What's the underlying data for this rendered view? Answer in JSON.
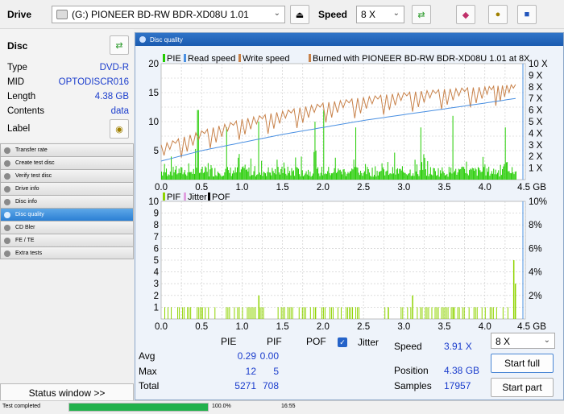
{
  "topbar": {
    "drive_label": "Drive",
    "drive_value": "(G:)   PIONEER BD-RW   BDR-XD08U 1.01",
    "speed_label": "Speed",
    "speed_value": "8 X"
  },
  "disc": {
    "title": "Disc",
    "fields": [
      {
        "key": "Type",
        "value": "DVD-R"
      },
      {
        "key": "MID",
        "value": "OPTODISCR016"
      },
      {
        "key": "Length",
        "value": "4.38 GB"
      },
      {
        "key": "Contents",
        "value": "data"
      }
    ],
    "label_key": "Label"
  },
  "nav": [
    {
      "label": "Transfer rate",
      "active": false
    },
    {
      "label": "Create test disc",
      "active": false
    },
    {
      "label": "Verify test disc",
      "active": false
    },
    {
      "label": "Drive info",
      "active": false
    },
    {
      "label": "Disc info",
      "active": false
    },
    {
      "label": "Disc quality",
      "active": true
    },
    {
      "label": "CD Bler",
      "active": false
    },
    {
      "label": "FE / TE",
      "active": false
    },
    {
      "label": "Extra tests",
      "active": false
    }
  ],
  "status_window_label": "Status window >>",
  "statusbar": {
    "text": "Test completed",
    "progress_value": 100.0,
    "percent": "100.0%",
    "time": "16:55"
  },
  "panel_title": "Disc quality",
  "chart_data": [
    {
      "type": "bar",
      "legend": [
        "PIE",
        "Read speed",
        "Write speed",
        "Burned with PIONEER BD-RW  BDR-XD08U 1.01 at 8X"
      ],
      "x_ticks": [
        "0.0",
        "0.5",
        "1.0",
        "1.5",
        "2.0",
        "2.5",
        "3.0",
        "3.5",
        "4.0",
        "4.5 GB"
      ],
      "y_ticks_left": [
        "5",
        "10",
        "15",
        "20"
      ],
      "y_ticks_right": [
        "1 X",
        "2 X",
        "3 X",
        "4 X",
        "5 X",
        "6 X",
        "7 X",
        "8 X",
        "9 X",
        "10 X"
      ],
      "xlim": [
        0,
        4.5
      ],
      "ylim": [
        0,
        20
      ],
      "y2lim": [
        0,
        10
      ],
      "pie_peaks": [
        [
          0.45,
          12
        ],
        [
          0.8,
          9
        ],
        [
          1.2,
          10
        ],
        [
          1.9,
          10
        ],
        [
          2.0,
          12
        ],
        [
          2.4,
          9
        ],
        [
          3.2,
          9
        ],
        [
          3.6,
          11
        ],
        [
          4.25,
          9
        ]
      ],
      "read_speed": [
        [
          0.0,
          1.6
        ],
        [
          0.5,
          2.5
        ],
        [
          1.0,
          3.2
        ],
        [
          1.5,
          3.9
        ],
        [
          2.0,
          4.5
        ],
        [
          2.5,
          5.1
        ],
        [
          3.0,
          5.6
        ],
        [
          3.5,
          6.1
        ],
        [
          4.0,
          6.6
        ],
        [
          4.38,
          7.0
        ]
      ],
      "write_speed": [
        [
          0.0,
          3.0
        ],
        [
          0.5,
          4.2
        ],
        [
          1.0,
          5.2
        ],
        [
          1.5,
          5.9
        ],
        [
          2.0,
          6.6
        ],
        [
          2.5,
          7.1
        ],
        [
          3.0,
          7.5
        ],
        [
          3.5,
          7.8
        ],
        [
          4.0,
          8.0
        ],
        [
          4.38,
          8.2
        ]
      ]
    },
    {
      "type": "bar",
      "legend": [
        "PIF",
        "Jitter",
        "POF"
      ],
      "x_ticks": [
        "0.0",
        "0.5",
        "1.0",
        "1.5",
        "2.0",
        "2.5",
        "3.0",
        "3.5",
        "4.0",
        "4.5 GB"
      ],
      "y_ticks_left": [
        "1",
        "2",
        "3",
        "4",
        "5",
        "6",
        "7",
        "8",
        "9",
        "10"
      ],
      "y_ticks_right": [
        "2%",
        "4%",
        "6%",
        "8%",
        "10%"
      ],
      "xlim": [
        0,
        4.5
      ],
      "ylim": [
        0,
        10
      ],
      "pif_peaks": [
        [
          0.5,
          1
        ],
        [
          1.2,
          2
        ],
        [
          1.9,
          1
        ],
        [
          2.8,
          1
        ],
        [
          3.1,
          2
        ],
        [
          3.6,
          1
        ],
        [
          4.35,
          5
        ],
        [
          4.37,
          3
        ]
      ]
    }
  ],
  "stats": {
    "headers": [
      "PIE",
      "PIF",
      "POF",
      "Jitter"
    ],
    "rows": [
      {
        "label": "Avg",
        "pie": "0.29",
        "pif": "0.00"
      },
      {
        "label": "Max",
        "pie": "12",
        "pif": "5"
      },
      {
        "label": "Total",
        "pie": "5271",
        "pif": "708"
      }
    ],
    "speed_label": "Speed",
    "speed_value": "3.91 X",
    "speed_select": "8 X",
    "position_label": "Position",
    "position_value": "4.38 GB",
    "samples_label": "Samples",
    "samples_value": "17957",
    "start_full": "Start full",
    "start_part": "Start part"
  },
  "colors": {
    "pie": "#22cc00",
    "pif": "#8fd400",
    "read": "#4a90e2",
    "write": "#c8824a",
    "accent": "#1a3ccc"
  }
}
